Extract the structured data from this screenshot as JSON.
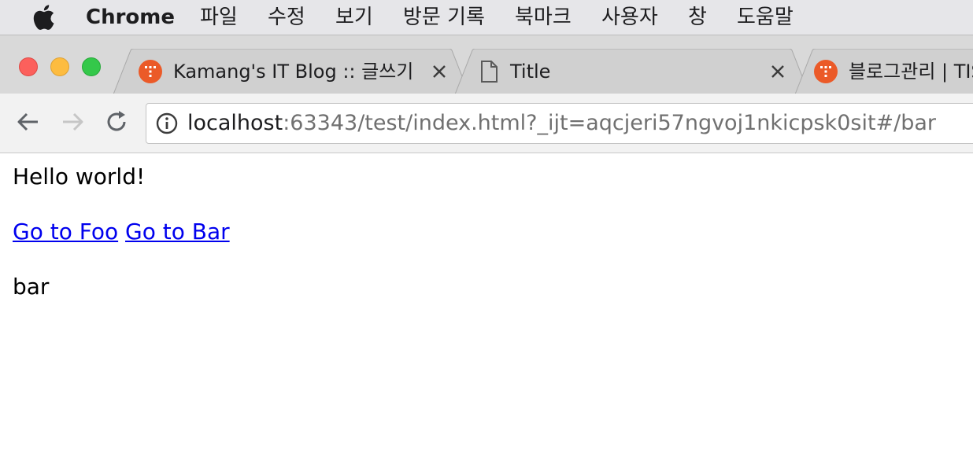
{
  "menubar": {
    "app_name": "Chrome",
    "items": [
      "파일",
      "수정",
      "보기",
      "방문 기록",
      "북마크",
      "사용자",
      "창",
      "도움말"
    ]
  },
  "tabs": [
    {
      "title": "Kamang's IT Blog :: 글쓰기",
      "favicon": "tistory-icon"
    },
    {
      "title": "Title",
      "favicon": "document-icon"
    },
    {
      "title": "블로그관리 | TIS",
      "favicon": "tistory-icon"
    }
  ],
  "address_bar": {
    "host": "localhost",
    "path": ":63343/test/index.html?_ijt=aqcjeri57ngvoj1nkicpsk0sit#/bar"
  },
  "page": {
    "heading": "Hello world!",
    "links": [
      "Go to Foo",
      "Go to Bar"
    ],
    "view_text": "bar"
  },
  "colors": {
    "link": "#0000ee",
    "favicon_accent": "#eb5a28"
  }
}
